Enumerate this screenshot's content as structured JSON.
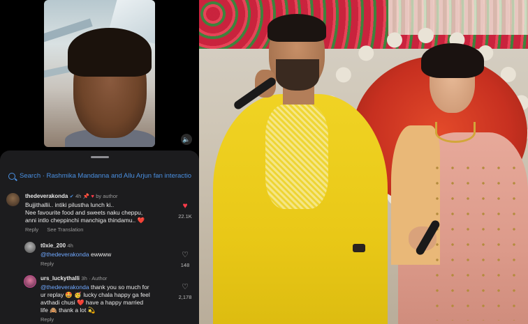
{
  "search": {
    "text": "Search · Rashmika Mandanna and Allu Arjun fan interactio"
  },
  "comments": [
    {
      "username": "thedeverakonda",
      "time": "4h",
      "by_author": "by author",
      "lines": [
        "Bujjithallii.. intiki pilustha lunch ki..",
        "Nee favourite food and sweets naku cheppu,",
        "anni intlo cheppinchi manchiga thindamu.. ❤️"
      ],
      "reply": "Reply",
      "see_translation": "See Translation",
      "likes": "22.1K"
    },
    {
      "username": "t0xie_200",
      "time": "4h",
      "mention": "@thedeverakonda",
      "text": "ewwww",
      "reply": "Reply",
      "likes": "148"
    },
    {
      "username": "urs_luckythalli",
      "time": "3h",
      "author_tag": "· Author",
      "mention": "@thedeverakonda",
      "lines": [
        "thank you so much for",
        "ur replay 🤩 🥳 lucky chala  happy ga feel",
        "avthadi chusi ❤️ have a happy married",
        "life 🙈 thank a lot 💫"
      ],
      "reply": "Reply",
      "likes": "2,178"
    }
  ],
  "icons": {
    "volume": "🔈"
  },
  "colors": {
    "link": "#4a90e2",
    "heart": "#ff3b4a",
    "sheet": "#1c1c1e"
  }
}
